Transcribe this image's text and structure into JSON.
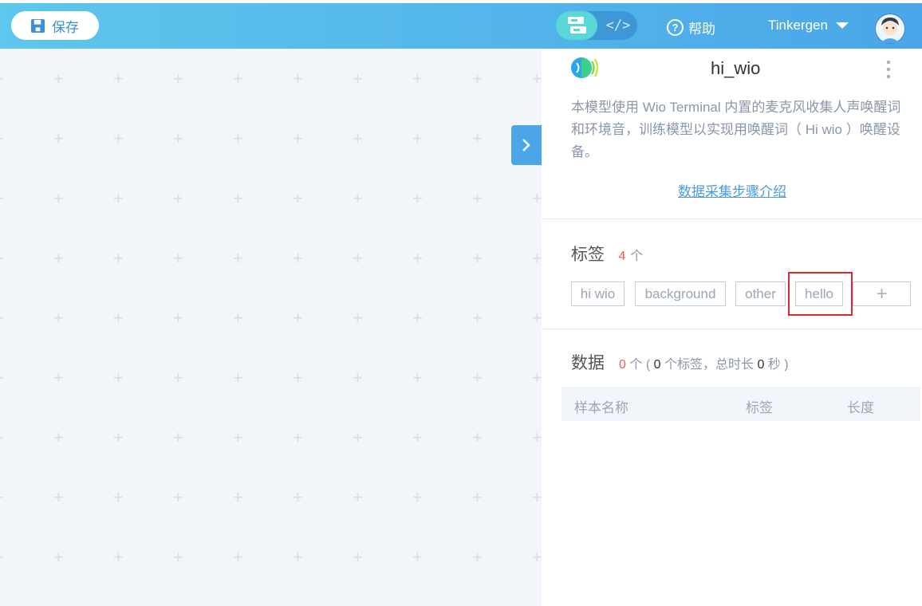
{
  "toolbar": {
    "save_label": "保存",
    "code_toggle": "</>",
    "help_label": "帮助",
    "user_name": "Tinkergen"
  },
  "model": {
    "name": "hi_wio",
    "description": "本模型使用 Wio Terminal 内置的麦克风收集人声唤醒词和环境音，训练模型以实现用唤醒词（ Hi wio ）唤醒设备。",
    "guide_link": "数据采集步骤介绍"
  },
  "labels": {
    "title": "标签",
    "count": "4",
    "unit": "个",
    "items": [
      "hi wio",
      "background",
      "other",
      "hello"
    ],
    "add_symbol": "+"
  },
  "data_section": {
    "title": "数据",
    "count": "0",
    "unit": "个",
    "summary_open": "( ",
    "label_count": "0",
    "label_text": "个标签，总时长",
    "duration": "0",
    "duration_unit": "秒 )",
    "columns": [
      "样本名称",
      "标签",
      "长度"
    ]
  },
  "colors": {
    "accent": "#4aa6e8",
    "highlight": "#e0262b",
    "count": "#f25b5b"
  }
}
